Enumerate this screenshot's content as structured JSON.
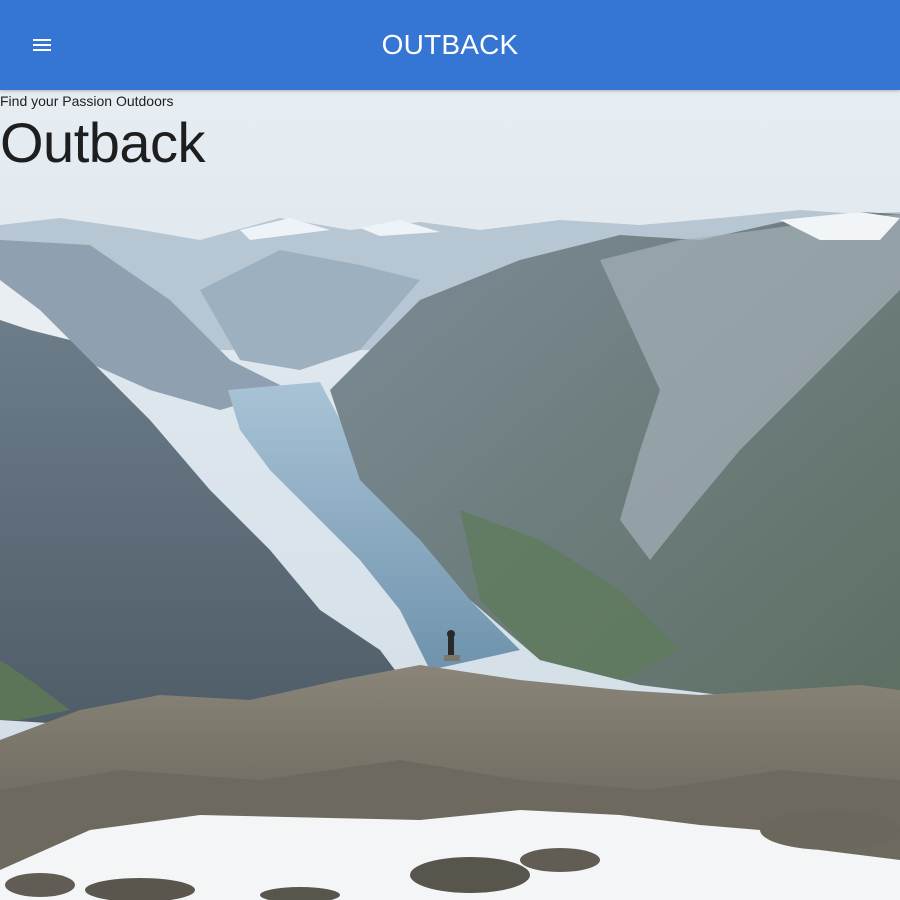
{
  "app_bar": {
    "title": "OUTBACK",
    "menu_icon": "menu-icon",
    "background": "#3575d3"
  },
  "hero": {
    "tagline": "Find your Passion Outdoors",
    "headline": "Outback",
    "image": "fjord-mountain-landscape"
  }
}
